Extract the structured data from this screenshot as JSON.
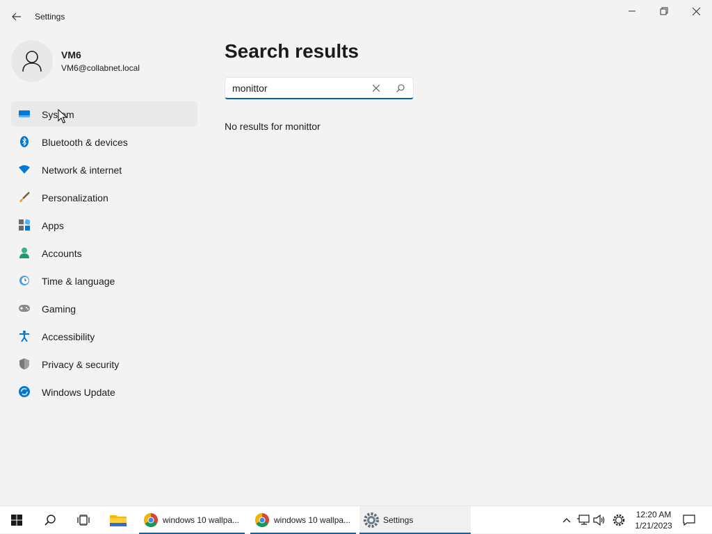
{
  "window": {
    "title": "Settings",
    "controls": {
      "minimize": "minimize-icon",
      "maximize": "restore-icon",
      "close": "close-icon"
    }
  },
  "profile": {
    "name": "VM6",
    "email": "VM6@collabnet.local"
  },
  "nav": {
    "items": [
      {
        "label": "System",
        "icon": "system-icon",
        "selected": true
      },
      {
        "label": "Bluetooth & devices",
        "icon": "bluetooth-icon"
      },
      {
        "label": "Network & internet",
        "icon": "wifi-icon"
      },
      {
        "label": "Personalization",
        "icon": "brush-icon"
      },
      {
        "label": "Apps",
        "icon": "apps-icon"
      },
      {
        "label": "Accounts",
        "icon": "accounts-icon"
      },
      {
        "label": "Time & language",
        "icon": "globe-clock-icon"
      },
      {
        "label": "Gaming",
        "icon": "gamepad-icon"
      },
      {
        "label": "Accessibility",
        "icon": "accessibility-icon"
      },
      {
        "label": "Privacy & security",
        "icon": "shield-icon"
      },
      {
        "label": "Windows Update",
        "icon": "update-icon"
      }
    ]
  },
  "main": {
    "title": "Search results",
    "search": {
      "value": "monittor",
      "placeholder": ""
    },
    "no_results": "No results for monittor"
  },
  "taskbar": {
    "tasks": [
      {
        "label": "windows 10 wallpa...",
        "icon": "chrome-icon"
      },
      {
        "label": "windows 10 wallpa...",
        "icon": "chrome-icon"
      },
      {
        "label": "Settings",
        "icon": "settings-gear-icon"
      }
    ],
    "time": "12:20 AM",
    "date": "1/21/2023"
  },
  "colors": {
    "accent": "#005fb8",
    "background": "#f3f3f3",
    "selected": "#e9e9e9"
  }
}
